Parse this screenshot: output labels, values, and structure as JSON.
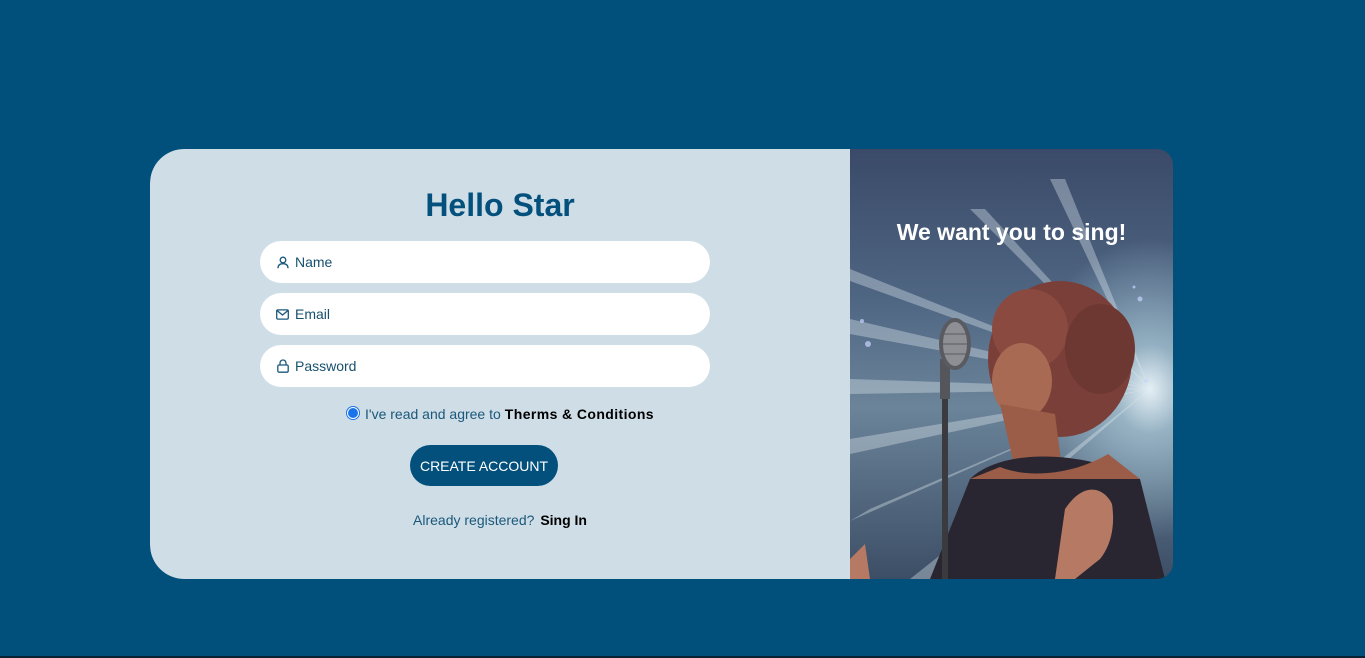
{
  "form": {
    "title": "Hello Star",
    "name_placeholder": "Name",
    "email_placeholder": "Email",
    "password_placeholder": "Password",
    "terms_text": "I've read and agree to",
    "terms_link": "Therms & Conditions",
    "terms_checked": true,
    "create_button": "CREATE ACCOUNT",
    "already_text": "Already registered?",
    "signin_link": "Sing In"
  },
  "hero": {
    "tagline": "We want you to sing!",
    "image_subject": "singer-with-microphone-photo"
  },
  "colors": {
    "page_bg": "#01507c",
    "form_bg": "#cfdde6",
    "accent": "#03507c",
    "input_bg": "#ffffff"
  },
  "icons": [
    "user-icon",
    "mail-icon",
    "lock-icon",
    "radio-checked-icon"
  ]
}
